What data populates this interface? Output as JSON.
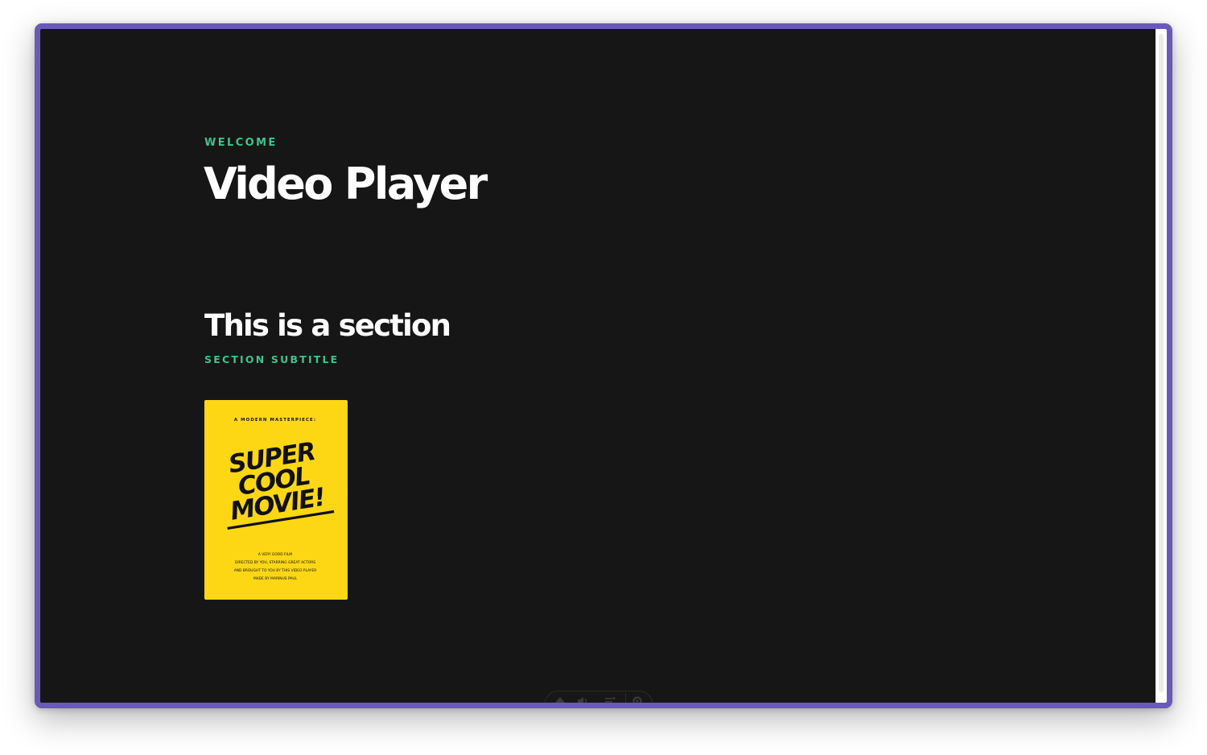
{
  "app": {
    "eyebrow": "WELCOME",
    "title": "Video Player"
  },
  "section": {
    "title": "This is a section",
    "subtitle": "SECTION SUBTITLE"
  },
  "poster": {
    "tagline": "A MODERN MASTERPIECE:",
    "title_lines": [
      "SUPER",
      "COOL",
      "MOVIE!"
    ],
    "credits": [
      "A VERY GOOD FILM",
      "DIRECTED BY YOU, STARRING GREAT ACTORS",
      "AND BROUGHT TO YOU BY THIS VIDEO PLAYER",
      "MADE BY MARINUS PAUL"
    ],
    "background_color": "#fdd714",
    "text_color": "#111111"
  },
  "controls": {
    "icons": [
      "eject-icon",
      "volume-icon",
      "playlist-icon",
      "settings-icon"
    ]
  },
  "colors": {
    "frame": "#6a5ab8",
    "background": "#161616",
    "accent": "#3dc48c"
  }
}
